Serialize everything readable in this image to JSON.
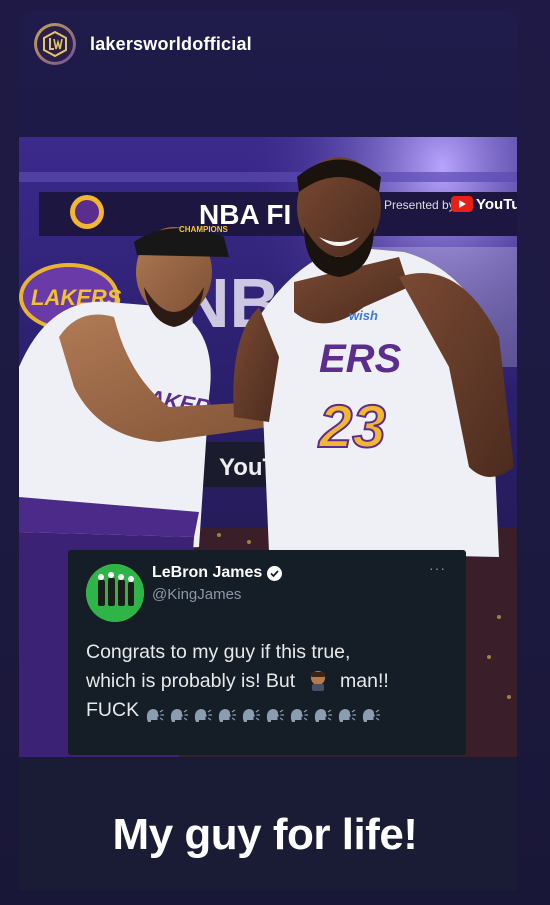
{
  "story": {
    "username": "lakersworldofficial",
    "caption": "My guy for life!"
  },
  "photo": {
    "banner_left": "NBA FI",
    "presented_by": "Presented by",
    "youtube": "YouTu",
    "youtube_lower": "YouTube",
    "jersey_number": "23",
    "jersey_word": "ERS",
    "jersey_word_left": "LAKER",
    "sponsor": "wish",
    "hat_text": "CHAMPIONS",
    "lakers_logo": "LAKERS"
  },
  "tweet": {
    "name": "LeBron James",
    "handle": "@KingJames",
    "more": "···",
    "text_line1": "Congrats to my guy if this true,",
    "text_line2_a": "which is probably is! But",
    "text_line2_b": "man!!",
    "text_line3": "FUCK",
    "emoji_count": 10
  }
}
